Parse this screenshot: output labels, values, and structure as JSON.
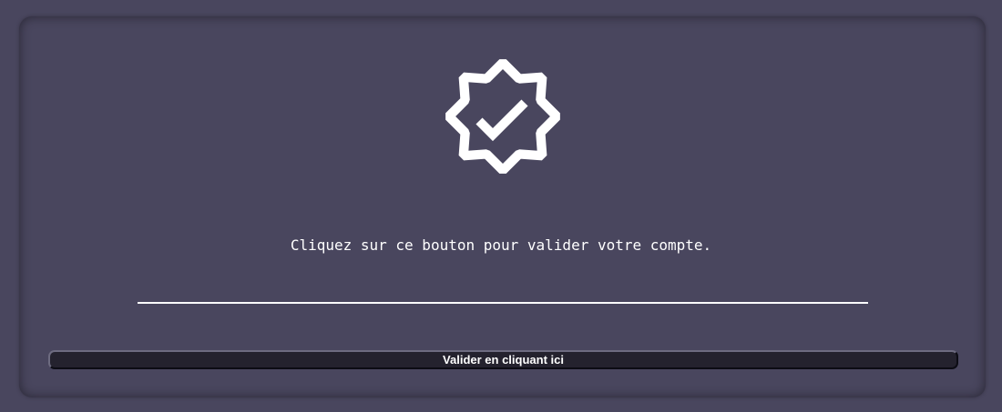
{
  "icons": {
    "badge": "verified-badge-check-icon"
  },
  "colors": {
    "background": "#49465e",
    "card": "#49465e",
    "text": "#ffffff",
    "button": "#24222e"
  },
  "content": {
    "message": "Cliquez sur ce bouton pour valider votre compte.",
    "button_label": "Valider en cliquant ici"
  }
}
